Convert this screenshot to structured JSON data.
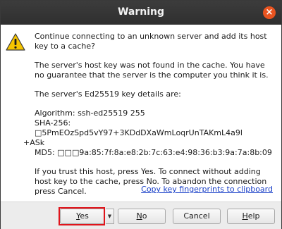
{
  "window": {
    "title": "Warning",
    "close_glyph": "×"
  },
  "icons": {
    "warning": "warning-triangle-icon",
    "close": "close-icon"
  },
  "message": {
    "line1": "Continue connecting to an unknown server and add its host key to a cache?",
    "line2": "The server's host key was not found in the cache. You have no guarantee that the server is the computer you think it is.",
    "line3": "The server's Ed25519 key details are:",
    "algorithm": "Algorithm:  ssh-ed25519 255",
    "sha256": "SHA-256:  □5PmEOzSpd5vY97+3KDdDXaWmLoqrUnTAKmL4a9l",
    "sha256_cont": "+ASk",
    "md5": "MD5:  □□□9a:85:7f:8a:e8:2b:7c:63:e4:98:36:b3:9a:7a:8b:09",
    "line4": "If you trust this host, press Yes. To connect without adding host key to the cache, press No. To abandon the connection press Cancel."
  },
  "link": {
    "copy_label": "Copy key fingerprints to clipboard"
  },
  "buttons": {
    "yes": {
      "pre": "",
      "ul": "Y",
      "post": "es"
    },
    "dropdown_glyph": "▼",
    "no": {
      "pre": "",
      "ul": "N",
      "post": "o"
    },
    "cancel": "Cancel",
    "help": {
      "pre": "",
      "ul": "H",
      "post": "elp"
    }
  },
  "colors": {
    "titlebar": "#333333",
    "close": "#e95420",
    "warning_fill": "#f5c400",
    "link": "#1a40c8",
    "highlight": "#e0141b"
  }
}
